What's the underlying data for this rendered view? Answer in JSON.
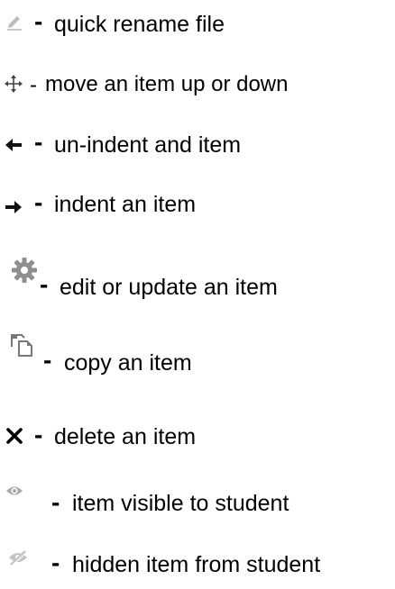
{
  "legend": {
    "items": [
      {
        "icon": "pencil-icon",
        "separator": "-",
        "label": "quick rename file"
      },
      {
        "icon": "move-arrows-icon",
        "separator": "-",
        "label": "move an item up or down"
      },
      {
        "icon": "arrow-left-icon",
        "separator": "-",
        "label": "un-indent and item"
      },
      {
        "icon": "arrow-right-icon",
        "separator": "-",
        "label": "indent an item"
      },
      {
        "icon": "gear-icon",
        "separator": "-",
        "label": "edit or update an item"
      },
      {
        "icon": "copy-icon",
        "separator": "-",
        "label": "copy an item"
      },
      {
        "icon": "close-icon",
        "separator": "-",
        "label": "delete an item"
      },
      {
        "icon": "eye-icon",
        "separator": "-",
        "label": "item visible to student"
      },
      {
        "icon": "eye-slash-icon",
        "separator": "-",
        "label": "hidden item from student"
      }
    ]
  },
  "colors": {
    "text": "#000000",
    "light_icon": "#9a9a9a",
    "dark_icon": "#111111"
  }
}
